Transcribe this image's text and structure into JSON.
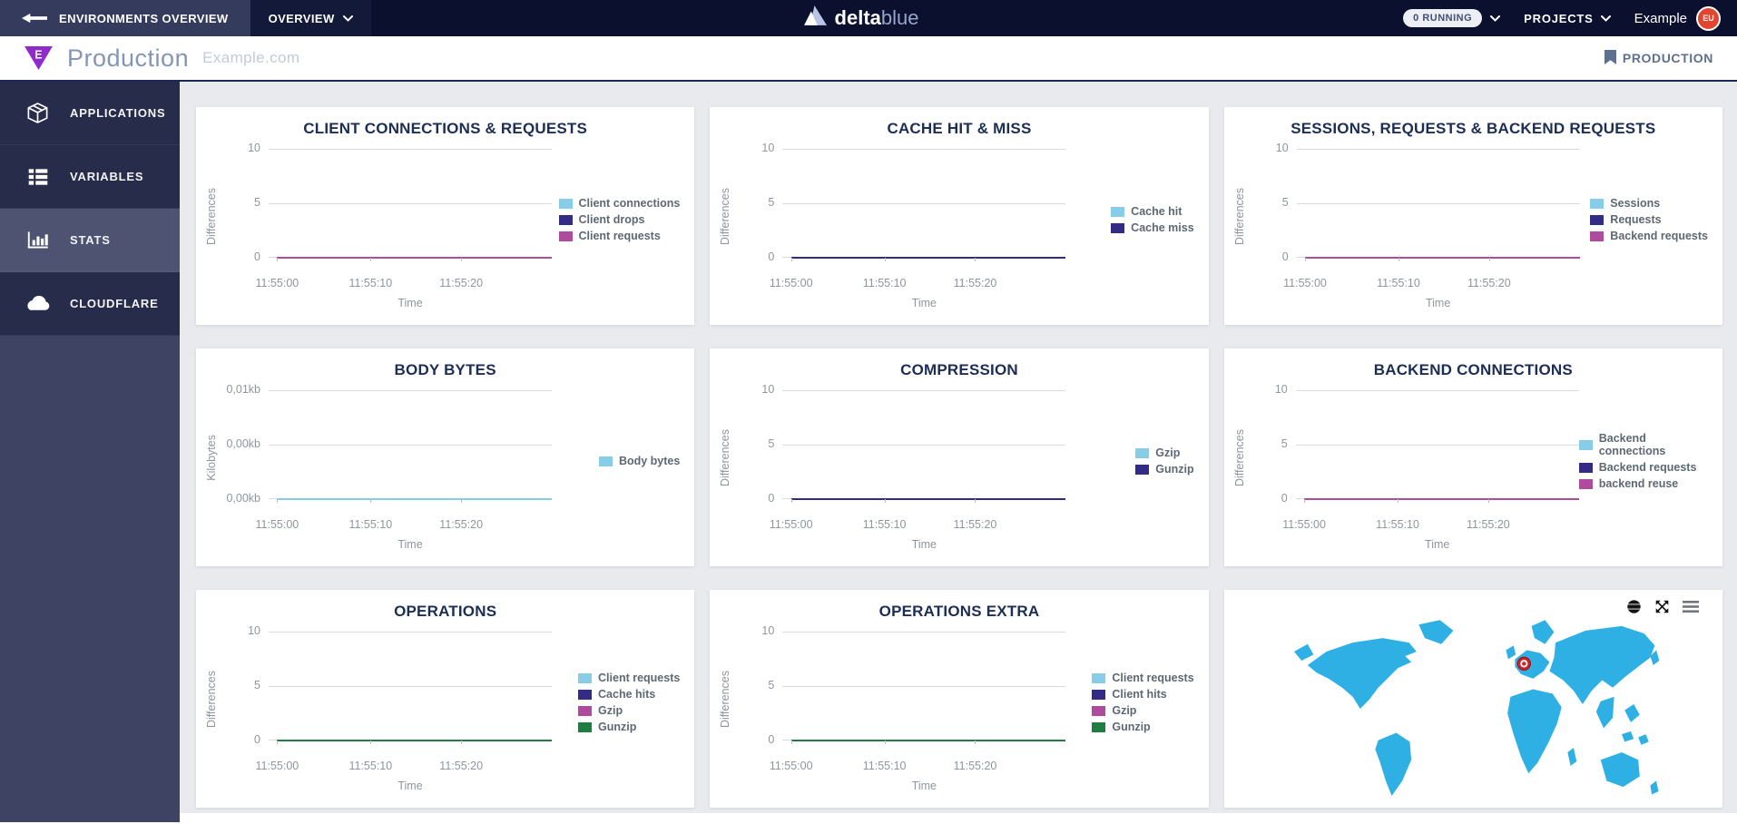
{
  "navbar": {
    "back_label": "ENVIRONMENTS OVERVIEW",
    "back_icon": "back-arrow-icon",
    "overview_label": "OVERVIEW",
    "brand_bold": "delta",
    "brand_light": "blue",
    "brand_icon": "deltablue-triangle-icon",
    "running_badge": "0 RUNNING",
    "projects_label": "PROJECTS",
    "account_label": "Example",
    "avatar_text": "EU"
  },
  "env_header": {
    "badge_letter": "E",
    "badge_icon": "environment-triangle-icon",
    "title": "Production",
    "subtitle": "Example.com",
    "bookmark_icon": "bookmark-icon",
    "bookmark_label": "PRODUCTION"
  },
  "sidebar": {
    "items": [
      {
        "label": "APPLICATIONS",
        "icon": "cube-icon",
        "active": false
      },
      {
        "label": "VARIABLES",
        "icon": "variables-list-icon",
        "active": false
      },
      {
        "label": "STATS",
        "icon": "bar-chart-icon",
        "active": true
      },
      {
        "label": "CLOUDFLARE",
        "icon": "cloud-icon",
        "active": false
      }
    ]
  },
  "colors": {
    "series_lightblue": "#87CDEA",
    "series_indigo": "#342B87",
    "series_magenta": "#AE4B9D",
    "series_green": "#1E7D40",
    "map_land": "#2FB0E5",
    "marker_red": "#D42027",
    "accent_purple": "#8F2BCB",
    "avatar_red": "#E2452F"
  },
  "chart_data": [
    {
      "type": "line",
      "title": "CLIENT CONNECTIONS & REQUESTS",
      "xlabel": "Time",
      "ylabel": "Differences",
      "x": [
        "11:55:00",
        "11:55:10",
        "11:55:20"
      ],
      "yticks": [
        "10",
        "5",
        "0"
      ],
      "ylim": [
        0,
        10
      ],
      "grid": true,
      "legend_position": "right",
      "series": [
        {
          "name": "Client connections",
          "color": "#87CDEA",
          "values": [
            0,
            0,
            0
          ]
        },
        {
          "name": "Client drops",
          "color": "#342B87",
          "values": [
            0,
            0,
            0
          ]
        },
        {
          "name": "Client requests",
          "color": "#AE4B9D",
          "values": [
            0,
            0,
            0
          ]
        }
      ]
    },
    {
      "type": "line",
      "title": "CACHE HIT & MISS",
      "xlabel": "Time",
      "ylabel": "Differences",
      "x": [
        "11:55:00",
        "11:55:10",
        "11:55:20"
      ],
      "yticks": [
        "10",
        "5",
        "0"
      ],
      "ylim": [
        0,
        10
      ],
      "grid": true,
      "legend_position": "right",
      "series": [
        {
          "name": "Cache hit",
          "color": "#87CDEA",
          "values": [
            0,
            0,
            0
          ]
        },
        {
          "name": "Cache miss",
          "color": "#342B87",
          "values": [
            0,
            0,
            0
          ]
        }
      ]
    },
    {
      "type": "line",
      "title": "SESSIONS, REQUESTS & BACKEND REQUESTS",
      "xlabel": "Time",
      "ylabel": "Differences",
      "x": [
        "11:55:00",
        "11:55:10",
        "11:55:20"
      ],
      "yticks": [
        "10",
        "5",
        "0"
      ],
      "ylim": [
        0,
        10
      ],
      "grid": true,
      "legend_position": "right",
      "series": [
        {
          "name": "Sessions",
          "color": "#87CDEA",
          "values": [
            0,
            0,
            0
          ]
        },
        {
          "name": "Requests",
          "color": "#342B87",
          "values": [
            0,
            0,
            0
          ]
        },
        {
          "name": "Backend requests",
          "color": "#AE4B9D",
          "values": [
            0,
            0,
            0
          ]
        }
      ]
    },
    {
      "type": "line",
      "title": "BODY BYTES",
      "xlabel": "Time",
      "ylabel": "Kilobytes",
      "x": [
        "11:55:00",
        "11:55:10",
        "11:55:20"
      ],
      "yticks": [
        "0,01kb",
        "0,00kb",
        "0,00kb"
      ],
      "ylim": [
        0,
        0.01
      ],
      "grid": true,
      "legend_position": "right",
      "series": [
        {
          "name": "Body bytes",
          "color": "#87CDEA",
          "values": [
            0,
            0,
            0
          ]
        }
      ]
    },
    {
      "type": "line",
      "title": "COMPRESSION",
      "xlabel": "Time",
      "ylabel": "Differences",
      "x": [
        "11:55:00",
        "11:55:10",
        "11:55:20"
      ],
      "yticks": [
        "10",
        "5",
        "0"
      ],
      "ylim": [
        0,
        10
      ],
      "grid": true,
      "legend_position": "right",
      "series": [
        {
          "name": "Gzip",
          "color": "#87CDEA",
          "values": [
            0,
            0,
            0
          ]
        },
        {
          "name": "Gunzip",
          "color": "#342B87",
          "values": [
            0,
            0,
            0
          ]
        }
      ]
    },
    {
      "type": "line",
      "title": "BACKEND CONNECTIONS",
      "xlabel": "Time",
      "ylabel": "Differences",
      "x": [
        "11:55:00",
        "11:55:10",
        "11:55:20"
      ],
      "yticks": [
        "10",
        "5",
        "0"
      ],
      "ylim": [
        0,
        10
      ],
      "grid": true,
      "legend_position": "right",
      "series": [
        {
          "name": "Backend connections",
          "color": "#87CDEA",
          "values": [
            0,
            0,
            0
          ]
        },
        {
          "name": "Backend requests",
          "color": "#342B87",
          "values": [
            0,
            0,
            0
          ]
        },
        {
          "name": "backend reuse",
          "color": "#AE4B9D",
          "values": [
            0,
            0,
            0
          ]
        }
      ]
    },
    {
      "type": "line",
      "title": "OPERATIONS",
      "xlabel": "Time",
      "ylabel": "Differences",
      "x": [
        "11:55:00",
        "11:55:10",
        "11:55:20"
      ],
      "yticks": [
        "10",
        "5",
        "0"
      ],
      "ylim": [
        0,
        10
      ],
      "grid": true,
      "legend_position": "right",
      "series": [
        {
          "name": "Client requests",
          "color": "#87CDEA",
          "values": [
            0,
            0,
            0
          ]
        },
        {
          "name": "Cache hits",
          "color": "#342B87",
          "values": [
            0,
            0,
            0
          ]
        },
        {
          "name": "Gzip",
          "color": "#AE4B9D",
          "values": [
            0,
            0,
            0
          ]
        },
        {
          "name": "Gunzip",
          "color": "#1E7D40",
          "values": [
            0,
            0,
            0
          ]
        }
      ]
    },
    {
      "type": "line",
      "title": "OPERATIONS EXTRA",
      "xlabel": "Time",
      "ylabel": "Differences",
      "x": [
        "11:55:00",
        "11:55:10",
        "11:55:20"
      ],
      "yticks": [
        "10",
        "5",
        "0"
      ],
      "ylim": [
        0,
        10
      ],
      "grid": true,
      "legend_position": "right",
      "series": [
        {
          "name": "Client requests",
          "color": "#87CDEA",
          "values": [
            0,
            0,
            0
          ]
        },
        {
          "name": "Client hits",
          "color": "#342B87",
          "values": [
            0,
            0,
            0
          ]
        },
        {
          "name": "Gzip",
          "color": "#AE4B9D",
          "values": [
            0,
            0,
            0
          ]
        },
        {
          "name": "Gunzip",
          "color": "#1E7D40",
          "values": [
            0,
            0,
            0
          ]
        }
      ]
    },
    {
      "type": "map",
      "land_color": "#2FB0E5",
      "controls": [
        "globe-icon",
        "fullscreen-expand-icon",
        "menu-icon"
      ],
      "marker": {
        "region": "Western Europe",
        "color": "#D42027"
      }
    }
  ]
}
